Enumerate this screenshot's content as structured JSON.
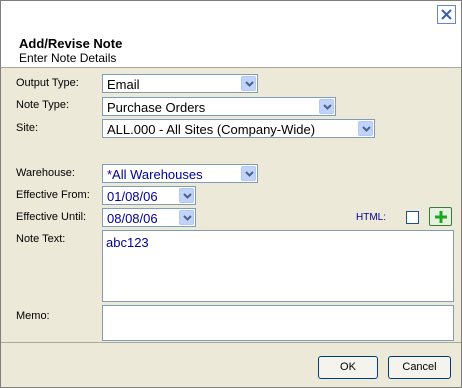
{
  "dialog": {
    "title": "Add/Revise Note",
    "subtitle": "Enter Note Details"
  },
  "fields": {
    "output_type": {
      "label": "Output Type:",
      "value": "Email"
    },
    "note_type": {
      "label": "Note Type:",
      "value": "Purchase Orders"
    },
    "site": {
      "label": "Site:",
      "value": "ALL.000 - All Sites (Company-Wide)"
    },
    "warehouse": {
      "label": "Warehouse:",
      "value": "*All Warehouses"
    },
    "effective_from": {
      "label": "Effective From:",
      "value": "01/08/06"
    },
    "effective_until": {
      "label": "Effective Until:",
      "value": "08/08/06"
    },
    "html": {
      "label": "HTML:",
      "checked": false
    },
    "note_text": {
      "label": "Note Text:",
      "value": "abc123"
    },
    "memo": {
      "label": "Memo:",
      "value": ""
    }
  },
  "buttons": {
    "ok": "OK",
    "cancel": "Cancel"
  },
  "icons": {
    "close": "close-icon",
    "add": "plus-icon",
    "dropdown": "chevron-down-icon"
  },
  "colors": {
    "value_blue": "#00009c",
    "dialog_bg": "#ece9d8"
  }
}
